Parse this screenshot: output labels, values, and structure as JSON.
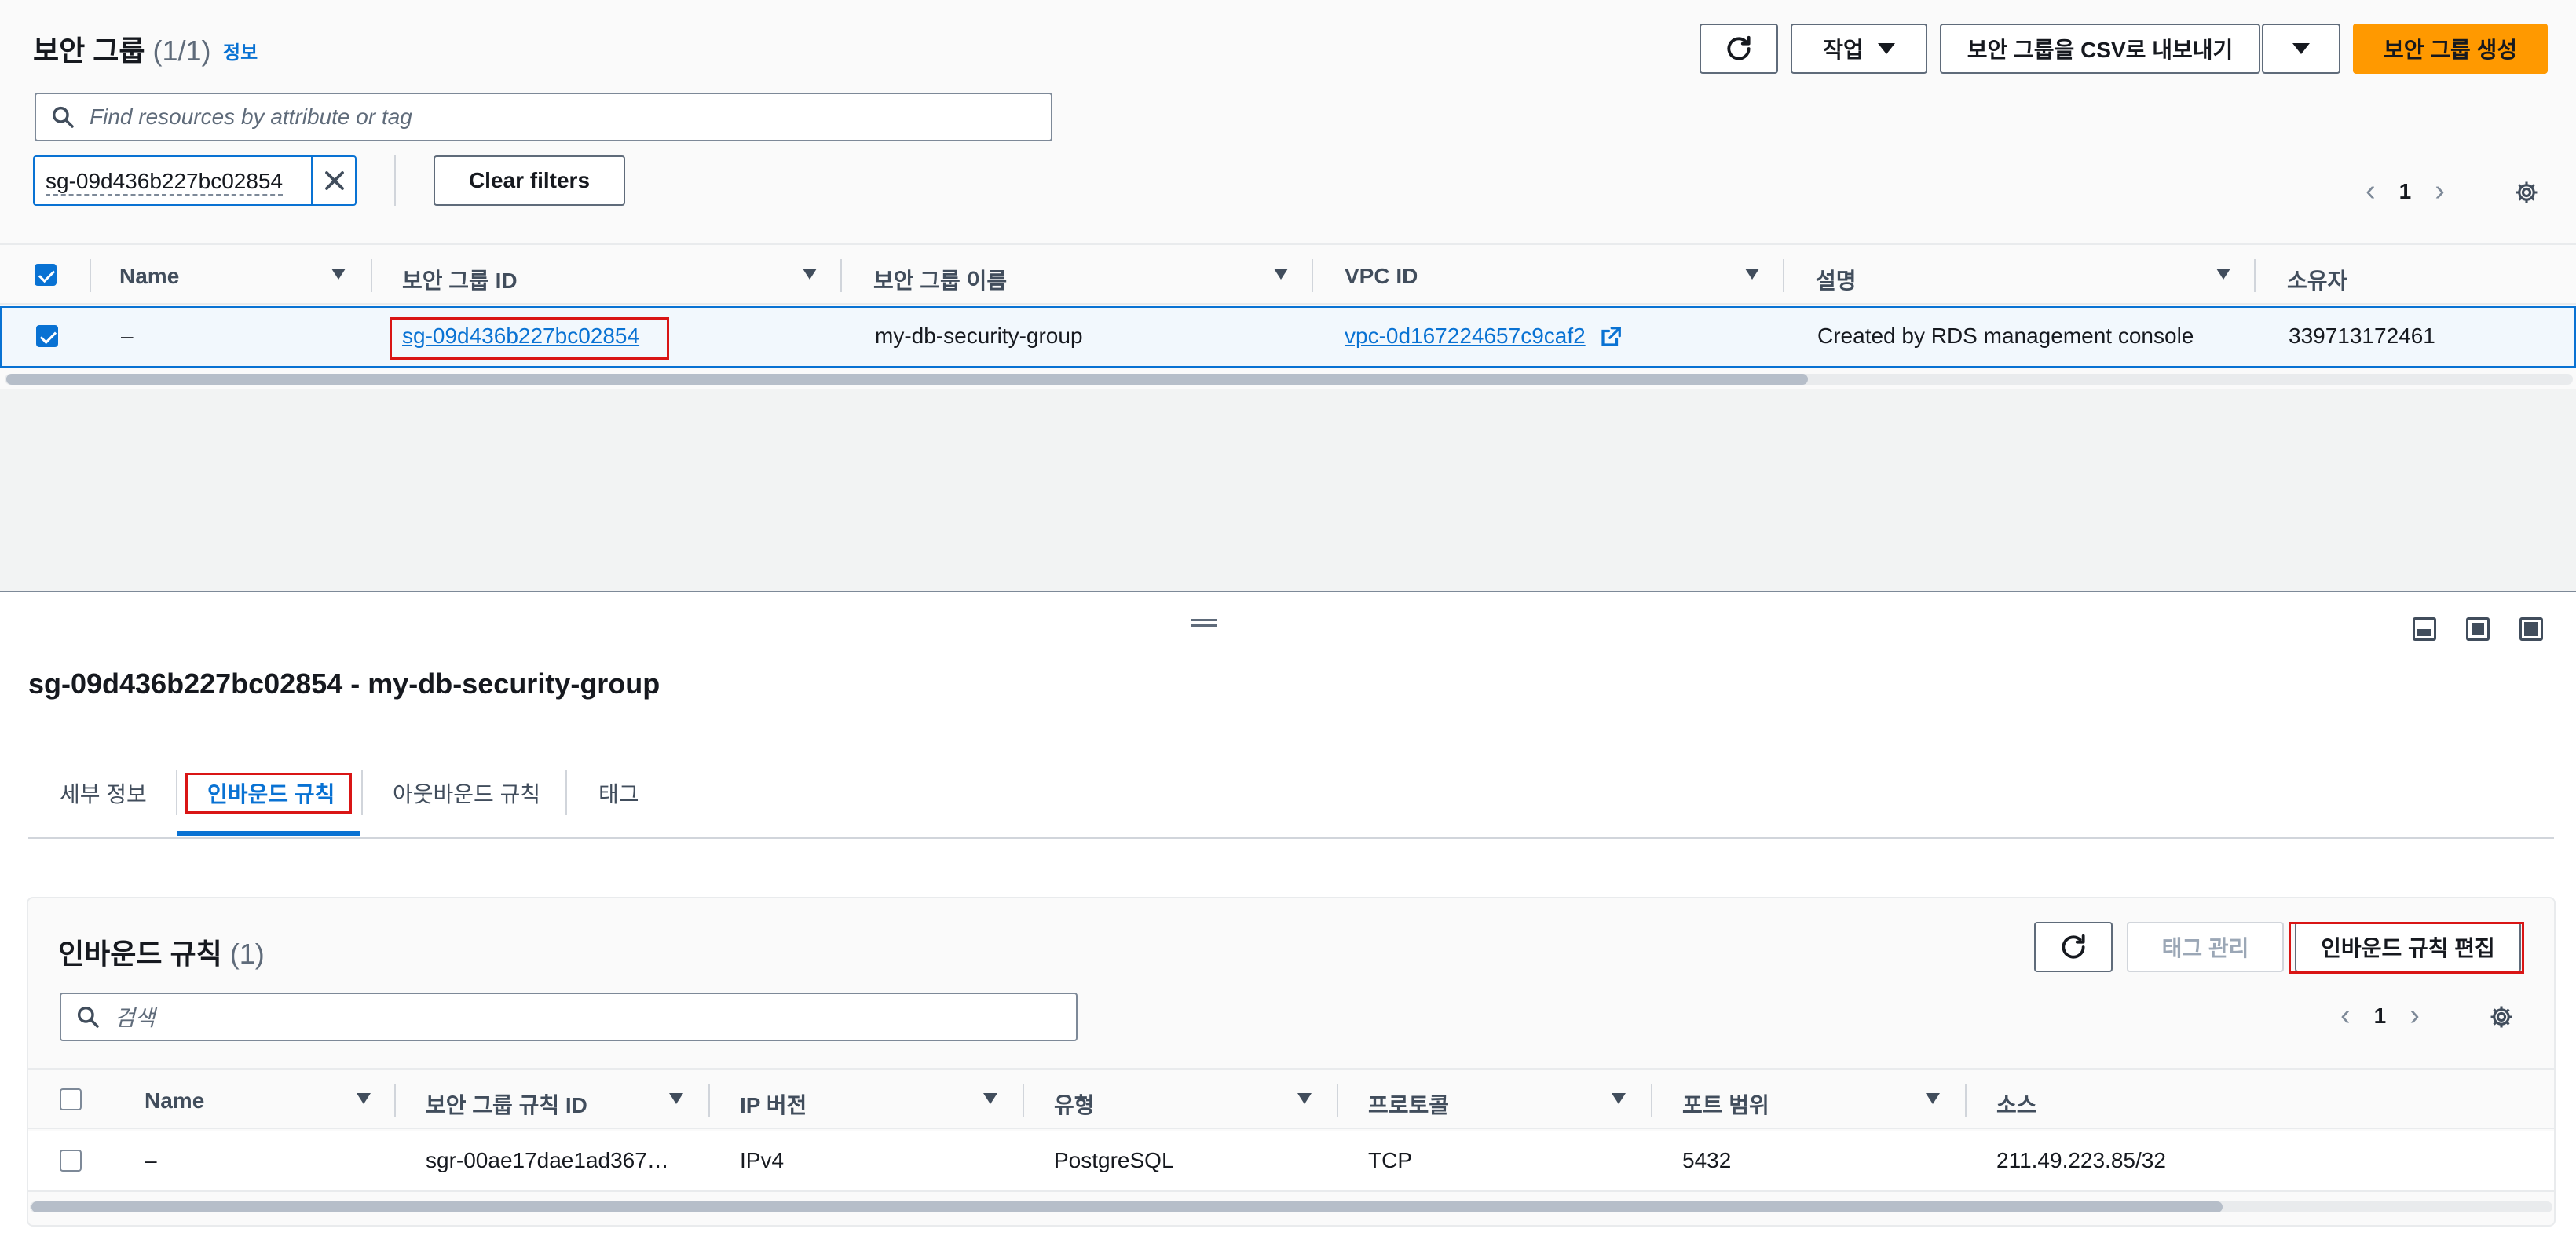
{
  "sg_list": {
    "title": "보안 그룹",
    "count": "(1/1)",
    "info_link": "정보",
    "actions_label": "작업",
    "export_label": "보안 그룹을 CSV로 내보내기",
    "create_label": "보안 그룹 생성",
    "search_placeholder": "Find resources by attribute or tag",
    "filter_token": "sg-09d436b227bc02854",
    "clear_filters_label": "Clear filters",
    "page": "1",
    "columns": [
      "Name",
      "보안 그룹 ID",
      "보안 그룹 이름",
      "VPC ID",
      "설명",
      "소유자"
    ],
    "rows": [
      {
        "name": "–",
        "sg_id": "sg-09d436b227bc02854",
        "sg_name": "my-db-security-group",
        "vpc_id": "vpc-0d167224657c9caf2",
        "description": "Created by RDS management console",
        "owner": "339713172461",
        "selected": true
      }
    ]
  },
  "detail": {
    "title": "sg-09d436b227bc02854 - my-db-security-group",
    "tabs": [
      "세부 정보",
      "인바운드 규칙",
      "아웃바운드 규칙",
      "태그"
    ],
    "active_tab": "인바운드 규칙"
  },
  "inbound": {
    "title": "인바운드 규칙",
    "count": "(1)",
    "manage_tags_label": "태그 관리",
    "edit_rules_label": "인바운드 규칙 편집",
    "search_placeholder": "검색",
    "page": "1",
    "columns": [
      "Name",
      "보안 그룹 규칙 ID",
      "IP 버전",
      "유형",
      "프로토콜",
      "포트 범위",
      "소스"
    ],
    "rows": [
      {
        "name": "–",
        "rule_id": "sgr-00ae17dae1ad367…",
        "ip_version": "IPv4",
        "type": "PostgreSQL",
        "protocol": "TCP",
        "port_range": "5432",
        "source": "211.49.223.85/32"
      }
    ]
  },
  "colors": {
    "primary": "#ff9900",
    "link": "#0972d3",
    "highlight": "#d91515",
    "selected_row_bg": "#f2f8fd"
  }
}
